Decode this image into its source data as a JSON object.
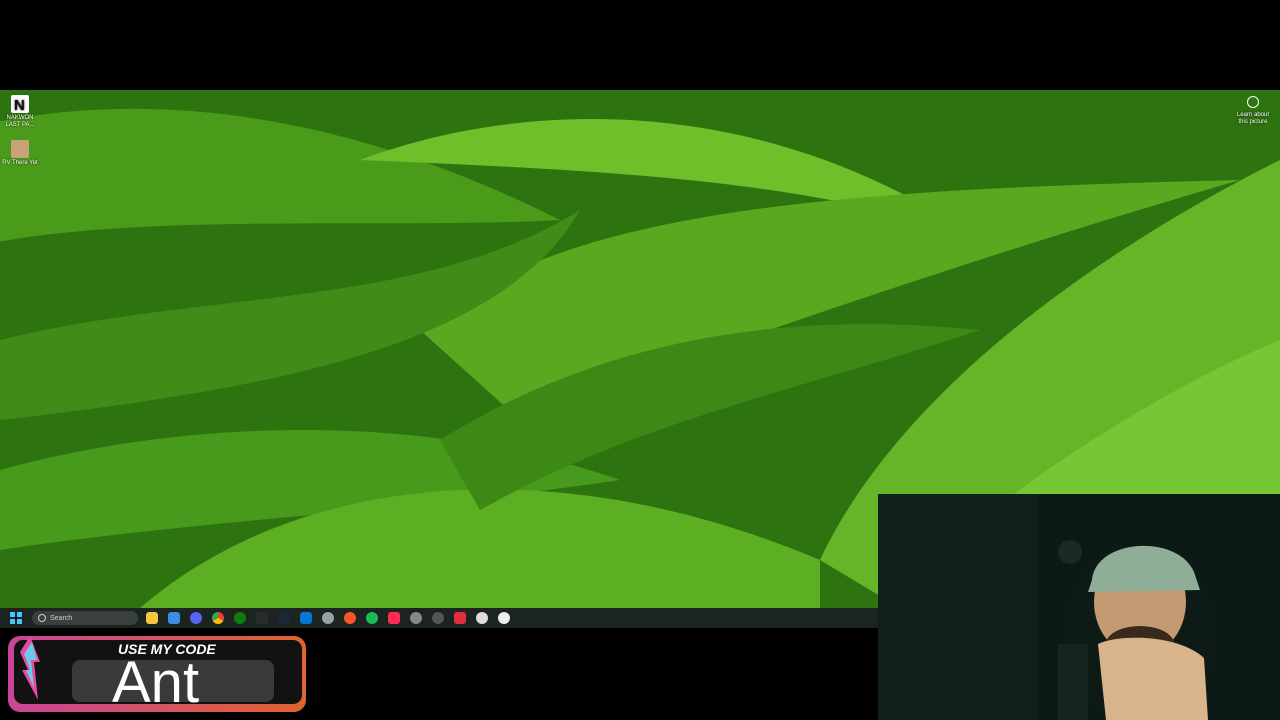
{
  "desktop": {
    "icons": [
      {
        "label": "NAKWON LAST PA...",
        "icon": "nakwon-game-icon"
      },
      {
        "label": "RV There Yet",
        "icon": "rv-game-icon"
      }
    ],
    "learn_about": "Learn about this picture"
  },
  "taskbar": {
    "search_placeholder": "Search",
    "apps": [
      "start",
      "file-explorer",
      "photos",
      "discord",
      "chrome",
      "xbox",
      "epic-games",
      "steam",
      "app",
      "obs",
      "brave",
      "spotify",
      "tiktok",
      "app",
      "app",
      "app",
      "app",
      "app"
    ]
  },
  "overlay": {
    "promo_label": "USE MY CODE",
    "code": "Ant"
  },
  "colors": {
    "taskbar": "#1c2420",
    "accent": "#4cc2ff",
    "promo_gradient_start": "#c8459a",
    "promo_gradient_end": "#e0632f"
  }
}
